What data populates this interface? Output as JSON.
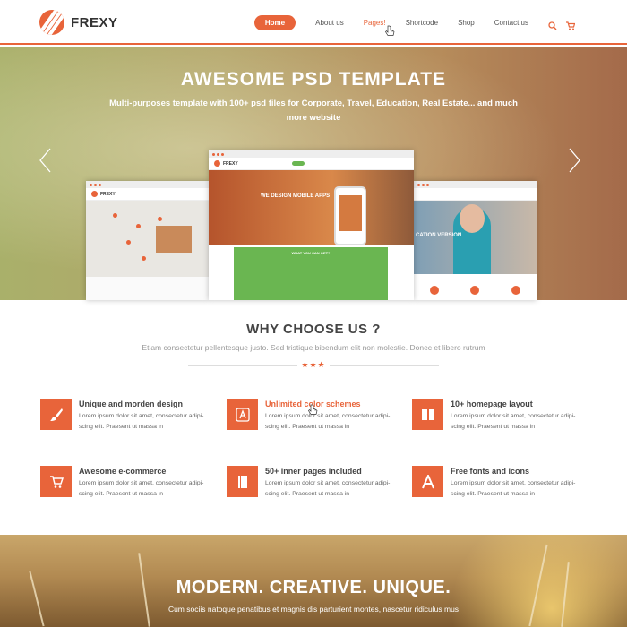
{
  "brand": {
    "name": "FREXY",
    "accent_color": "#e8643a"
  },
  "nav": {
    "items": [
      {
        "label": "Home",
        "active": true
      },
      {
        "label": "About us"
      },
      {
        "label": "Pages!"
      },
      {
        "label": "Shortcode"
      },
      {
        "label": "Shop"
      },
      {
        "label": "Contact us"
      }
    ],
    "icons": [
      "search-icon",
      "cart-icon"
    ]
  },
  "hero": {
    "title": "AWESOME PSD TEMPLATE",
    "subtitle": "Multi-purposes template with 100+ psd files for Corporate, Travel, Education, Real Estate... and much more website",
    "mockups": {
      "left_brand": "FREXY",
      "center_brand": "FREXY",
      "center_headline": "WE DESIGN MOBILE APPS",
      "center_panel_title": "WHAT YOU CAN GET?",
      "right_caption": "CATION VERSION"
    }
  },
  "why": {
    "title": "WHY CHOOSE US ?",
    "subtitle": "Etiam consectetur pellentesque justo. Sed tristique bibendum elit non molestie. Donec et libero rutrum",
    "stars": "★★★",
    "features": [
      {
        "title": "Unique and morden design",
        "desc": "Lorem ipsum dolor sit amet, consectetur adipi-scing elit. Praesent ut massa in",
        "icon": "brush-icon"
      },
      {
        "title": "Unlimited color schemes",
        "desc": "Lorem ipsum dolor sit amet, consectetur adipi-scing elit. Praesent ut massa in",
        "icon": "app-store-icon",
        "highlight": true
      },
      {
        "title": "10+ homepage layout",
        "desc": "Lorem ipsum dolor sit amet, consectetur adipi-scing elit. Praesent ut massa in",
        "icon": "layout-icon"
      },
      {
        "title": "Awesome e-commerce",
        "desc": "Lorem ipsum dolor sit amet, consectetur adipi-scing elit. Praesent ut massa in",
        "icon": "cart-icon"
      },
      {
        "title": "50+ inner pages included",
        "desc": "Lorem ipsum dolor sit amet, consectetur adipi-scing elit. Praesent ut massa in",
        "icon": "book-icon"
      },
      {
        "title": "Free fonts and icons",
        "desc": "Lorem ipsum dolor sit amet, consectetur adipi-scing elit. Praesent ut massa in",
        "icon": "font-icon"
      }
    ]
  },
  "banner": {
    "title": "MODERN. CREATIVE. UNIQUE.",
    "subtitle": "Cum sociis natoque penatibus et magnis dis parturient montes, nascetur ridiculus mus"
  }
}
